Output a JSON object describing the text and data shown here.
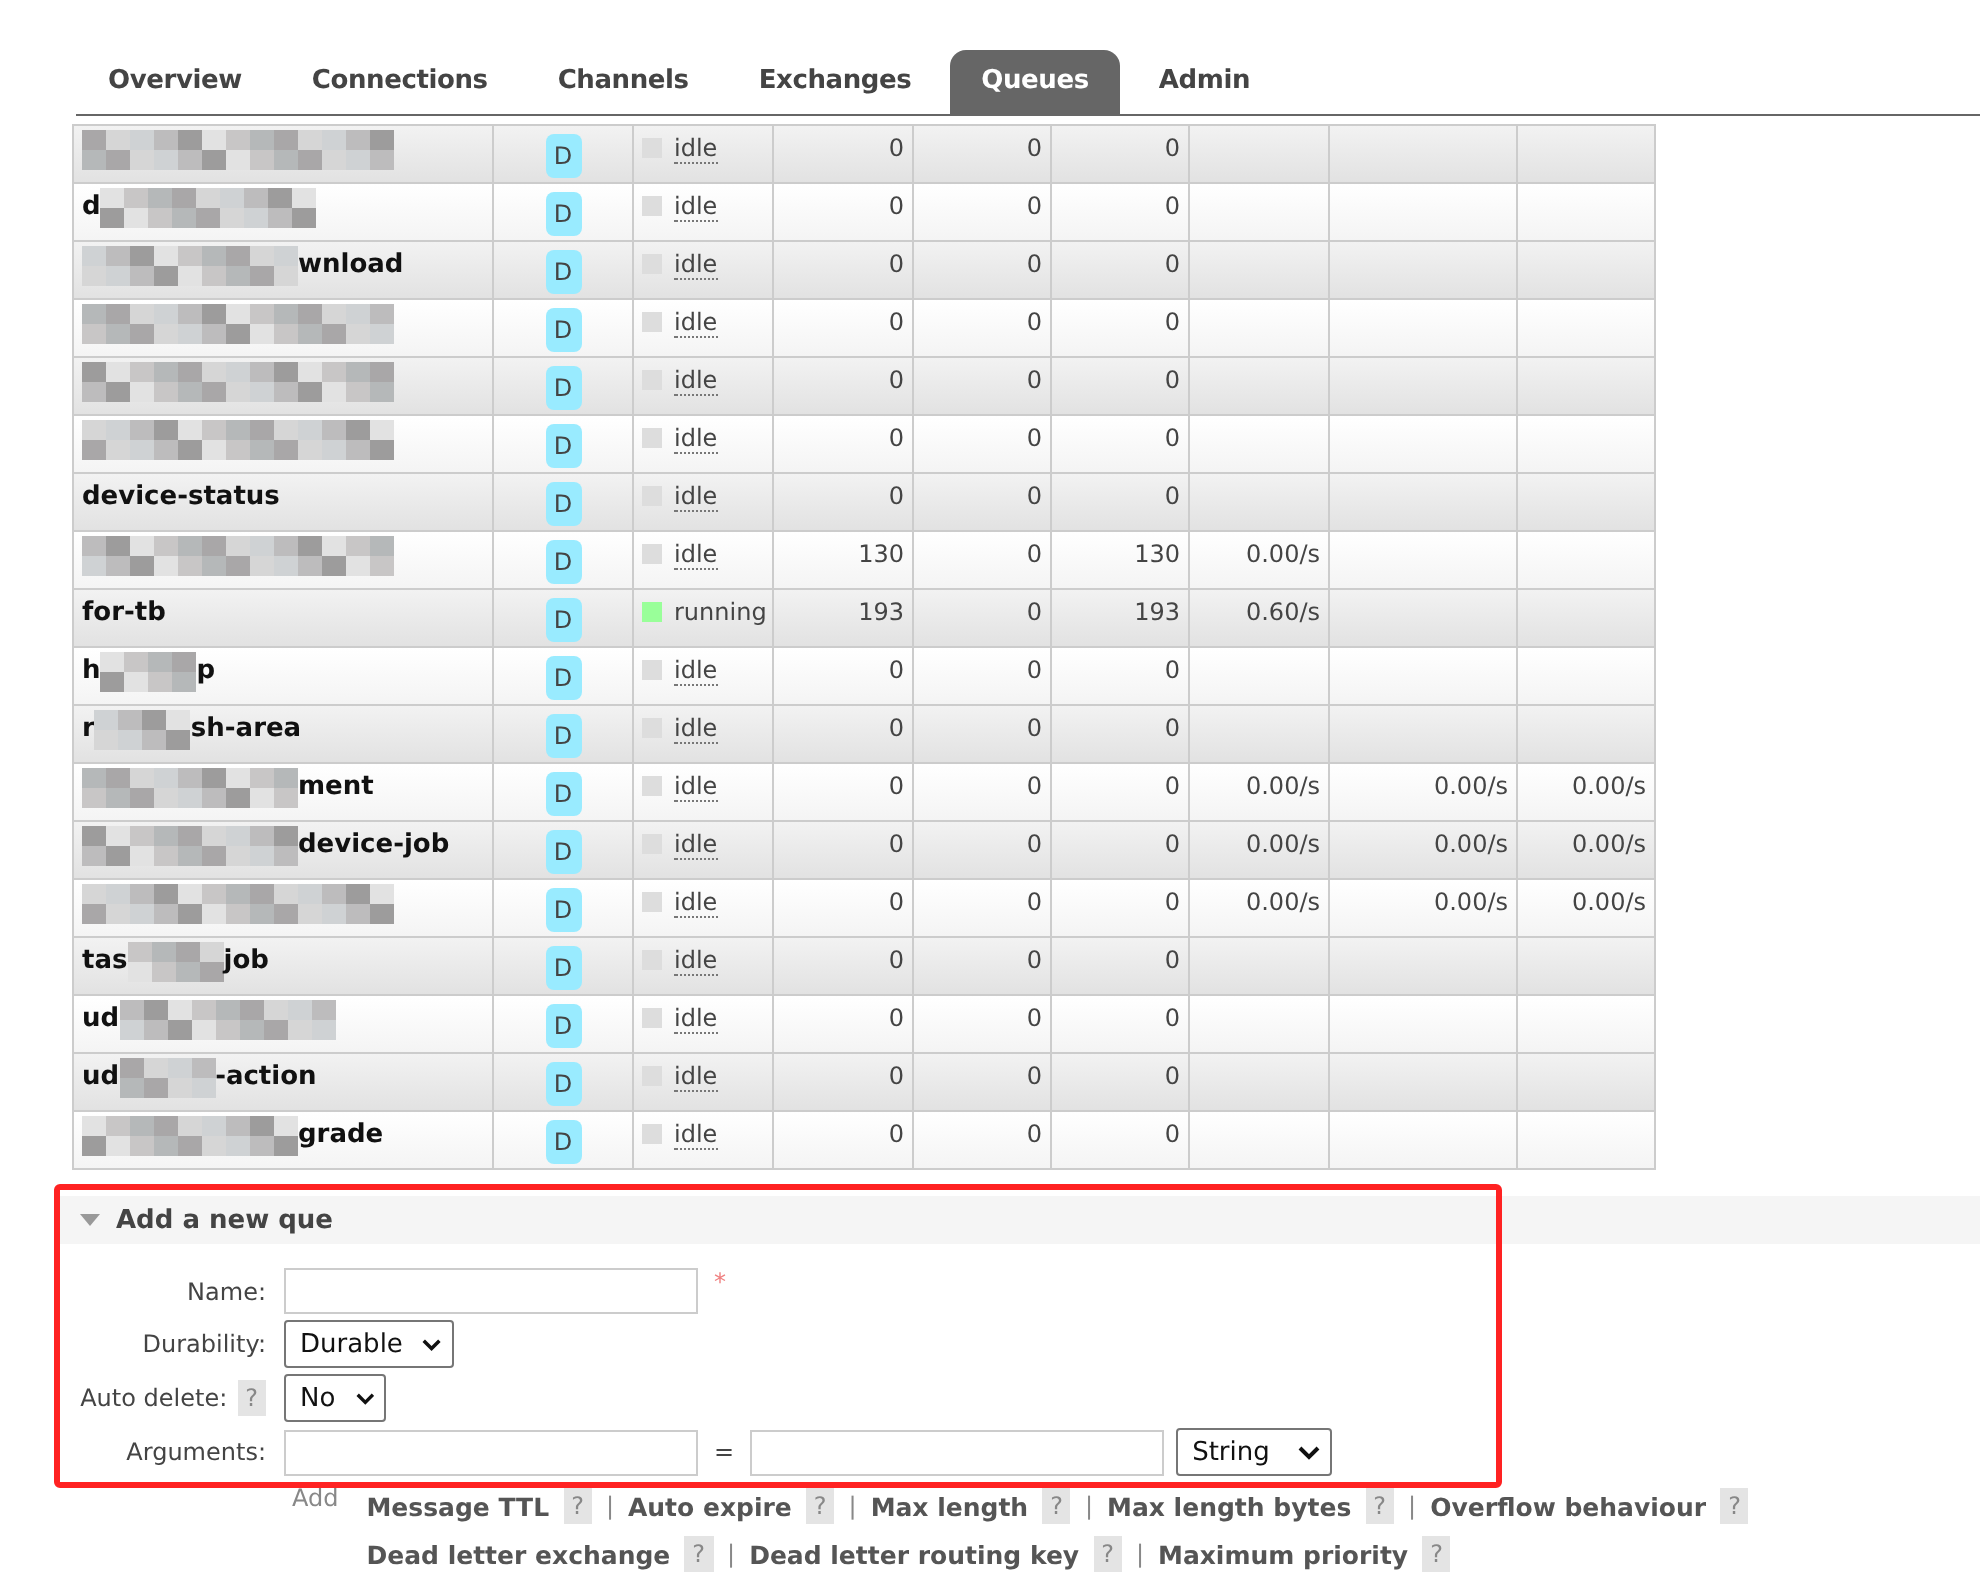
{
  "tabs": [
    {
      "label": "Overview",
      "selected": false
    },
    {
      "label": "Connections",
      "selected": false
    },
    {
      "label": "Channels",
      "selected": false
    },
    {
      "label": "Exchanges",
      "selected": false
    },
    {
      "label": "Queues",
      "selected": true
    },
    {
      "label": "Admin",
      "selected": false
    }
  ],
  "queues": [
    {
      "name_parts": [
        {
          "kind": "mosaic"
        }
      ],
      "type": "D",
      "state": {
        "kind": "idle",
        "label": "idle"
      },
      "ready": "0",
      "unacked": "0",
      "total": "0"
    },
    {
      "name_parts": [
        {
          "kind": "text",
          "text": "d"
        },
        {
          "kind": "mosaic"
        }
      ],
      "type": "D",
      "state": {
        "kind": "idle",
        "label": "idle"
      },
      "ready": "0",
      "unacked": "0",
      "total": "0"
    },
    {
      "name_parts": [
        {
          "kind": "mosaic"
        },
        {
          "kind": "text",
          "text": "wnload"
        }
      ],
      "type": "D",
      "state": {
        "kind": "idle",
        "label": "idle"
      },
      "ready": "0",
      "unacked": "0",
      "total": "0"
    },
    {
      "name_parts": [
        {
          "kind": "mosaic"
        }
      ],
      "type": "D",
      "state": {
        "kind": "idle",
        "label": "idle"
      },
      "ready": "0",
      "unacked": "0",
      "total": "0"
    },
    {
      "name_parts": [
        {
          "kind": "mosaic"
        }
      ],
      "type": "D",
      "state": {
        "kind": "idle",
        "label": "idle"
      },
      "ready": "0",
      "unacked": "0",
      "total": "0"
    },
    {
      "name_parts": [
        {
          "kind": "mosaic"
        }
      ],
      "type": "D",
      "state": {
        "kind": "idle",
        "label": "idle"
      },
      "ready": "0",
      "unacked": "0",
      "total": "0"
    },
    {
      "name_parts": [
        {
          "kind": "text",
          "text": "device-status"
        }
      ],
      "type": "D",
      "state": {
        "kind": "idle",
        "label": "idle"
      },
      "ready": "0",
      "unacked": "0",
      "total": "0"
    },
    {
      "name_parts": [
        {
          "kind": "mosaic"
        }
      ],
      "type": "D",
      "state": {
        "kind": "idle",
        "label": "idle"
      },
      "ready": "130",
      "unacked": "0",
      "total": "130",
      "rates": [
        "0.00/s"
      ]
    },
    {
      "name_parts": [
        {
          "kind": "text",
          "text": "for-tb"
        }
      ],
      "type": "D",
      "state": {
        "kind": "running",
        "label": "running"
      },
      "ready": "193",
      "unacked": "0",
      "total": "193",
      "rates": [
        "0.60/s"
      ]
    },
    {
      "name_parts": [
        {
          "kind": "text",
          "text": "h"
        },
        {
          "kind": "mosaic"
        },
        {
          "kind": "text",
          "text": "p"
        }
      ],
      "type": "D",
      "state": {
        "kind": "idle",
        "label": "idle"
      },
      "ready": "0",
      "unacked": "0",
      "total": "0"
    },
    {
      "name_parts": [
        {
          "kind": "text",
          "text": "r"
        },
        {
          "kind": "mosaic"
        },
        {
          "kind": "text",
          "text": "sh-area"
        }
      ],
      "type": "D",
      "state": {
        "kind": "idle",
        "label": "idle"
      },
      "ready": "0",
      "unacked": "0",
      "total": "0"
    },
    {
      "name_parts": [
        {
          "kind": "mosaic"
        },
        {
          "kind": "text",
          "text": "ment"
        }
      ],
      "type": "D",
      "state": {
        "kind": "idle",
        "label": "idle"
      },
      "ready": "0",
      "unacked": "0",
      "total": "0",
      "rates": [
        "0.00/s",
        "0.00/s",
        "0.00/s"
      ]
    },
    {
      "name_parts": [
        {
          "kind": "mosaic"
        },
        {
          "kind": "text",
          "text": "device-job"
        }
      ],
      "type": "D",
      "state": {
        "kind": "idle",
        "label": "idle"
      },
      "ready": "0",
      "unacked": "0",
      "total": "0",
      "rates": [
        "0.00/s",
        "0.00/s",
        "0.00/s"
      ]
    },
    {
      "name_parts": [
        {
          "kind": "mosaic"
        }
      ],
      "type": "D",
      "state": {
        "kind": "idle",
        "label": "idle"
      },
      "ready": "0",
      "unacked": "0",
      "total": "0",
      "rates": [
        "0.00/s",
        "0.00/s",
        "0.00/s"
      ]
    },
    {
      "name_parts": [
        {
          "kind": "text",
          "text": "tas"
        },
        {
          "kind": "mosaic"
        },
        {
          "kind": "text",
          "text": "job"
        }
      ],
      "type": "D",
      "state": {
        "kind": "idle",
        "label": "idle"
      },
      "ready": "0",
      "unacked": "0",
      "total": "0"
    },
    {
      "name_parts": [
        {
          "kind": "text",
          "text": "ud"
        },
        {
          "kind": "mosaic"
        }
      ],
      "type": "D",
      "state": {
        "kind": "idle",
        "label": "idle"
      },
      "ready": "0",
      "unacked": "0",
      "total": "0"
    },
    {
      "name_parts": [
        {
          "kind": "text",
          "text": "ud"
        },
        {
          "kind": "mosaic"
        },
        {
          "kind": "text",
          "text": "-action"
        }
      ],
      "type": "D",
      "state": {
        "kind": "idle",
        "label": "idle"
      },
      "ready": "0",
      "unacked": "0",
      "total": "0"
    },
    {
      "name_parts": [
        {
          "kind": "mosaic"
        },
        {
          "kind": "text",
          "text": "grade"
        }
      ],
      "type": "D",
      "state": {
        "kind": "idle",
        "label": "idle"
      },
      "ready": "0",
      "unacked": "0",
      "total": "0"
    }
  ],
  "add_queue": {
    "title": "Add a new que",
    "expanded": true,
    "fields": [
      {
        "kind": "text",
        "label": "Name:",
        "required_mark": "*"
      },
      {
        "kind": "select",
        "label": "Durability:",
        "value": "Durable"
      },
      {
        "kind": "select",
        "label": "Auto delete:",
        "help": "?",
        "value": "No"
      },
      {
        "kind": "arguments",
        "label": "Arguments:",
        "equals": "=",
        "type_value": "String"
      }
    ],
    "add_label": "Add",
    "argument_links": [
      [
        {
          "label": "Message TTL",
          "help": "?"
        },
        {
          "label": "Auto expire",
          "help": "?"
        },
        {
          "label": "Max length",
          "help": "?"
        },
        {
          "label": "Max length bytes",
          "help": "?"
        },
        {
          "label": "Overflow behaviour",
          "help": "?"
        }
      ],
      [
        {
          "label": "Dead letter exchange",
          "help": "?"
        },
        {
          "label": "Dead letter routing key",
          "help": "?"
        },
        {
          "label": "Maximum priority",
          "help": "?"
        }
      ]
    ],
    "separator": "|"
  },
  "highlight": {
    "shown": true
  }
}
